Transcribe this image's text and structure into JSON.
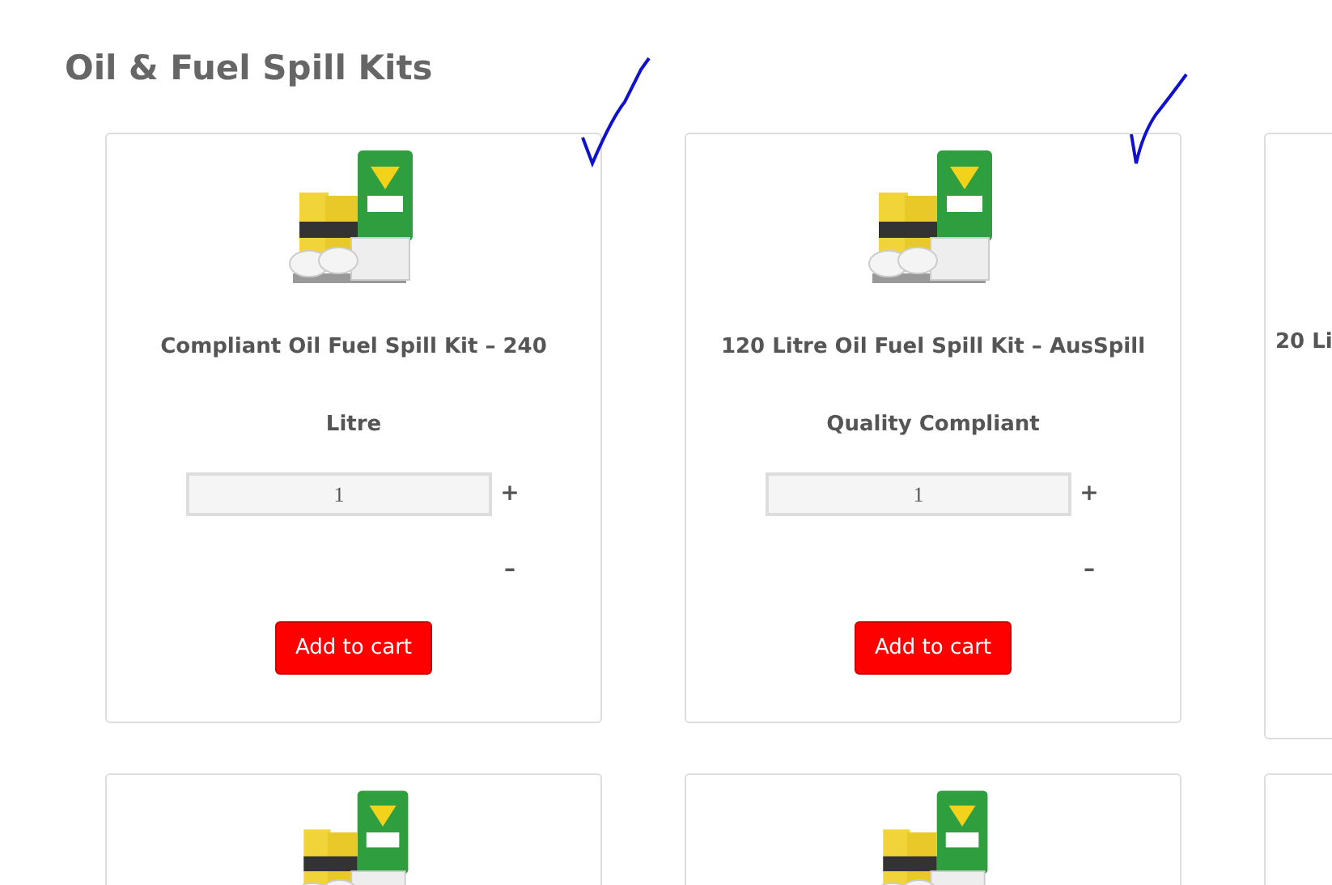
{
  "page_title": "Oil & Fuel Spill Kits",
  "products": [
    {
      "kind": "full",
      "title": "Compliant Oil Fuel Spill Kit – 240 Litre",
      "quantity": "1",
      "plus": "+",
      "minus": "–",
      "button": "Add to cart"
    },
    {
      "kind": "full",
      "title": "120 Litre Oil Fuel Spill Kit – AusSpill Quality Compliant",
      "quantity": "1",
      "plus": "+",
      "minus": "–",
      "button": "Add to cart"
    },
    {
      "kind": "partial",
      "title": "20 Li"
    },
    {
      "kind": "image_only"
    },
    {
      "kind": "image_only"
    },
    {
      "kind": "image_only"
    }
  ]
}
